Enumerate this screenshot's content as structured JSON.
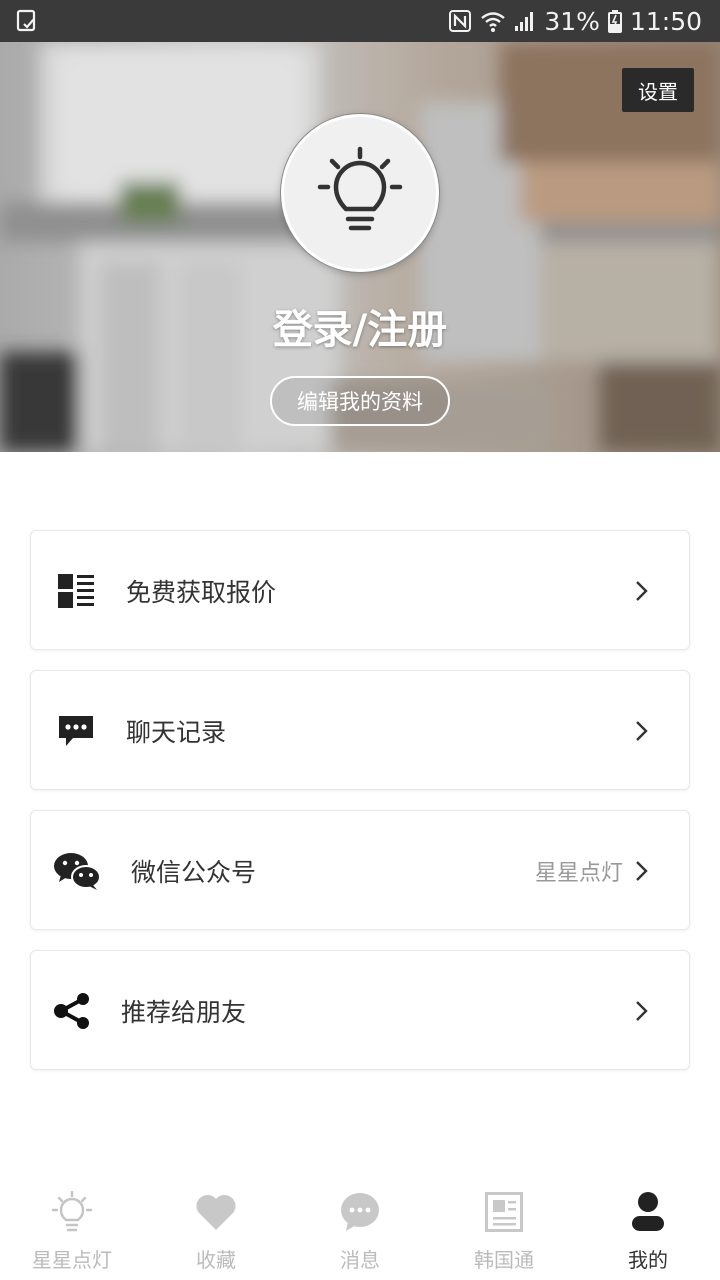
{
  "status_bar": {
    "battery": "31%",
    "time": "11:50"
  },
  "header": {
    "settings_label": "设置",
    "login_label": "登录/注册",
    "edit_profile_label": "编辑我的资料"
  },
  "menu": {
    "items": [
      {
        "label": "免费获取报价",
        "icon": "quote-list-icon",
        "right_text": ""
      },
      {
        "label": "聊天记录",
        "icon": "chat-bubble-icon",
        "right_text": ""
      },
      {
        "label": "微信公众号",
        "icon": "wechat-icon",
        "right_text": "星星点灯"
      },
      {
        "label": "推荐给朋友",
        "icon": "share-icon",
        "right_text": ""
      }
    ]
  },
  "tabbar": {
    "tabs": [
      {
        "label": "星星点灯",
        "icon": "lightbulb-icon",
        "active": false
      },
      {
        "label": "收藏",
        "icon": "heart-icon",
        "active": false
      },
      {
        "label": "消息",
        "icon": "message-icon",
        "active": false
      },
      {
        "label": "韩国通",
        "icon": "newspaper-icon",
        "active": false
      },
      {
        "label": "我的",
        "icon": "person-icon",
        "active": true
      }
    ]
  },
  "colors": {
    "status_bar_bg": "#3a3a3a",
    "text_primary": "#333333",
    "text_secondary": "#999999",
    "tab_inactive": "#bbbbbb"
  }
}
